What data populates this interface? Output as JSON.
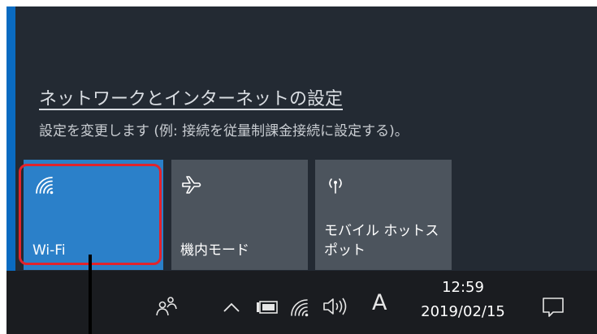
{
  "settings": {
    "link_text": "ネットワークとインターネットの設定",
    "description": "設定を変更します (例: 接続を従量制課金接続に設定する)。"
  },
  "tiles": [
    {
      "label": "Wi-Fi",
      "icon": "wifi-icon",
      "state": "on"
    },
    {
      "label": "機内モード",
      "icon": "airplane-icon",
      "state": "off"
    },
    {
      "label": "モバイル ホットス\nポット",
      "icon": "hotspot-icon",
      "state": "off"
    }
  ],
  "taskbar": {
    "icons": [
      "people-icon",
      "chevron-up-icon",
      "battery-icon",
      "wifi-icon",
      "volume-icon",
      "action-center-icon"
    ],
    "ime_label": "A",
    "clock_time": "12:59",
    "clock_date": "2019/02/15"
  },
  "colors": {
    "panel_bg": "#232a33",
    "accent": "#0a6bc1",
    "wifi_tile_on": "#2b80c9",
    "tile_off": "#4c545d",
    "taskbar_bg": "#1a1c20",
    "callout": "#e2232c"
  }
}
